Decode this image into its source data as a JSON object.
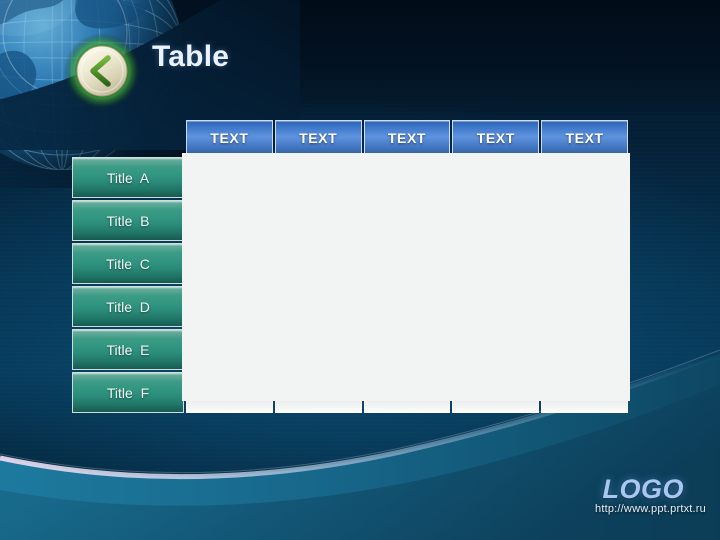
{
  "slide": {
    "title": "Table",
    "background_color": "#05263f",
    "accent_blue": "#4f86d6",
    "accent_green": "#2f9583"
  },
  "nav": {
    "back_button_label": "back-chevron"
  },
  "table": {
    "column_headers": [
      "TEXT",
      "TEXT",
      "TEXT",
      "TEXT",
      "TEXT"
    ],
    "row_titles": [
      "Title  A",
      "Title  B",
      "Title  C",
      "Title  D",
      "Title  E",
      "Title  F"
    ],
    "rows": [
      [
        "",
        "",
        "",
        "",
        ""
      ],
      [
        "",
        "",
        "",
        "",
        ""
      ],
      [
        "",
        "",
        "",
        "",
        ""
      ],
      [
        "",
        "",
        "",
        "",
        ""
      ],
      [
        "",
        "",
        "",
        "",
        ""
      ],
      [
        "",
        "",
        "",
        "",
        ""
      ]
    ],
    "header_color": "#4f86d6",
    "title_column_color": "#2f9583",
    "cell_color": "#eceeee"
  },
  "footer": {
    "logo": "LOGO",
    "url": "http://www.ppt.prtxt.ru"
  }
}
